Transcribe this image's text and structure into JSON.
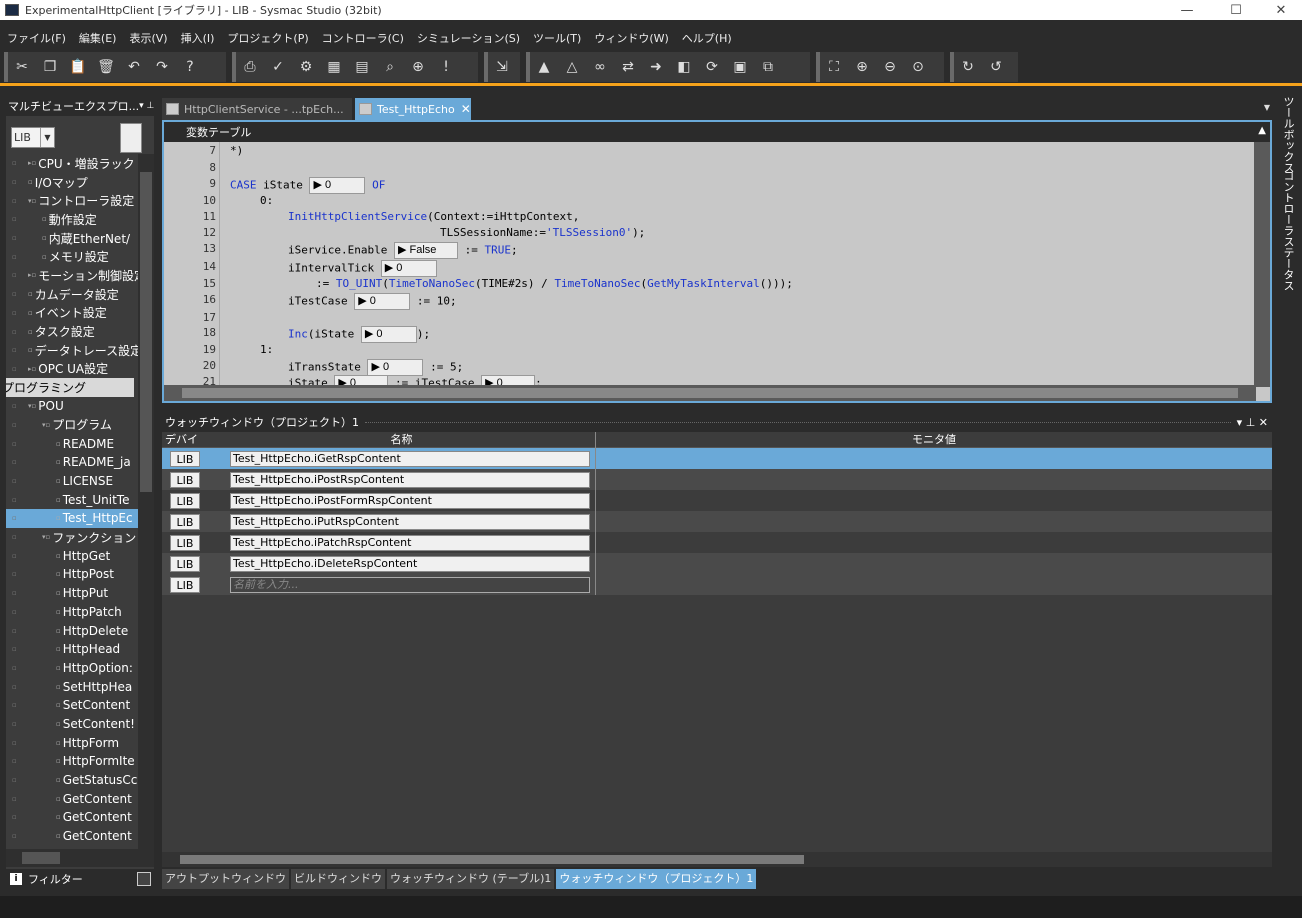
{
  "window": {
    "title": "ExperimentalHttpClient [ライブラリ] - LIB - Sysmac Studio (32bit)",
    "minimize": "—",
    "maximize": "☐",
    "close": "✕"
  },
  "menu": [
    "ファイル(F)",
    "編集(E)",
    "表示(V)",
    "挿入(I)",
    "プロジェクト(P)",
    "コントローラ(C)",
    "シミュレーション(S)",
    "ツール(T)",
    "ウィンドウ(W)",
    "ヘルプ(H)"
  ],
  "left_panel": {
    "title": "マルチビューエクスプロ...",
    "pin": "▾ ⊥",
    "selector_value": "LIB",
    "tree": [
      {
        "label": "CPU・増設ラック",
        "indent": 1,
        "icon": "▸▫"
      },
      {
        "label": "I/Oマップ",
        "indent": 1,
        "icon": "▫"
      },
      {
        "label": "コントローラ設定",
        "indent": 1,
        "icon": "▾▫"
      },
      {
        "label": "動作設定",
        "indent": 2,
        "icon": "▫"
      },
      {
        "label": "内蔵EtherNet/",
        "indent": 2,
        "icon": "▫"
      },
      {
        "label": "メモリ設定",
        "indent": 2,
        "icon": "▫"
      },
      {
        "label": "モーション制御設定",
        "indent": 1,
        "icon": "▸▫"
      },
      {
        "label": "カムデータ設定",
        "indent": 1,
        "icon": "▫"
      },
      {
        "label": "イベント設定",
        "indent": 1,
        "icon": "▫"
      },
      {
        "label": "タスク設定",
        "indent": 1,
        "icon": "▫"
      },
      {
        "label": "データトレース設定",
        "indent": 1,
        "icon": "▫"
      },
      {
        "label": "OPC UA設定",
        "indent": 1,
        "icon": "▸▫"
      },
      {
        "label": "プログラミング",
        "indent": 0,
        "icon": "",
        "group": true
      },
      {
        "label": "POU",
        "indent": 1,
        "icon": "▾▫"
      },
      {
        "label": "プログラム",
        "indent": 2,
        "icon": "▾▫"
      },
      {
        "label": "README",
        "indent": 3,
        "icon": "▫"
      },
      {
        "label": "README_ja",
        "indent": 3,
        "icon": "▫"
      },
      {
        "label": "LICENSE",
        "indent": 3,
        "icon": "▫"
      },
      {
        "label": "Test_UnitTe",
        "indent": 3,
        "icon": "▫"
      },
      {
        "label": "Test_HttpEc",
        "indent": 3,
        "icon": "▫",
        "selected": true
      },
      {
        "label": "ファンクション",
        "indent": 2,
        "icon": "▾▫"
      },
      {
        "label": "HttpGet",
        "indent": 3,
        "icon": "▫"
      },
      {
        "label": "HttpPost",
        "indent": 3,
        "icon": "▫"
      },
      {
        "label": "HttpPut",
        "indent": 3,
        "icon": "▫"
      },
      {
        "label": "HttpPatch",
        "indent": 3,
        "icon": "▫"
      },
      {
        "label": "HttpDelete",
        "indent": 3,
        "icon": "▫"
      },
      {
        "label": "HttpHead",
        "indent": 3,
        "icon": "▫"
      },
      {
        "label": "HttpOption:",
        "indent": 3,
        "icon": "▫"
      },
      {
        "label": "SetHttpHea",
        "indent": 3,
        "icon": "▫"
      },
      {
        "label": "SetContent",
        "indent": 3,
        "icon": "▫"
      },
      {
        "label": "SetContent!",
        "indent": 3,
        "icon": "▫"
      },
      {
        "label": "HttpForm",
        "indent": 3,
        "icon": "▫"
      },
      {
        "label": "HttpFormIte",
        "indent": 3,
        "icon": "▫"
      },
      {
        "label": "GetStatusCc",
        "indent": 3,
        "icon": "▫"
      },
      {
        "label": "GetContent",
        "indent": 3,
        "icon": "▫"
      },
      {
        "label": "GetContent",
        "indent": 3,
        "icon": "▫"
      },
      {
        "label": "GetContent",
        "indent": 3,
        "icon": "▫"
      }
    ],
    "filter_label": "フィルター"
  },
  "tabs": [
    {
      "label": "HttpClientService - ...tpEch...",
      "active": false
    },
    {
      "label": "Test_HttpEcho",
      "active": true,
      "close": "✕"
    }
  ],
  "editor": {
    "var_table_label": "変数テーブル",
    "lines": [
      {
        "n": "7",
        "code": "*)"
      },
      {
        "n": "8",
        "code": ""
      },
      {
        "n": "9",
        "code": "CASE iState [0] OF"
      },
      {
        "n": "10",
        "code": "0:"
      },
      {
        "n": "11",
        "code": "InitHttpClientService(Context:=iHttpContext,"
      },
      {
        "n": "12",
        "code": "TLSSessionName:='TLSSession0');"
      },
      {
        "n": "13",
        "code": "iService.Enable [False] := TRUE;"
      },
      {
        "n": "14",
        "code": "iIntervalTick [0]"
      },
      {
        "n": "15",
        "code": ":= TO_UINT(TimeToNanoSec(TIME#2s) / TimeToNanoSec(GetMyTaskInterval()));"
      },
      {
        "n": "16",
        "code": "iTestCase [0] := 10;"
      },
      {
        "n": "17",
        "code": ""
      },
      {
        "n": "18",
        "code": "Inc(iState [0]);"
      },
      {
        "n": "19",
        "code": "1:"
      },
      {
        "n": "20",
        "code": "iTransState [0] := 5;"
      },
      {
        "n": "21",
        "code": "iState [0] := iTestCase [0];"
      }
    ],
    "monitor_values": {
      "istate": "▶ 0",
      "enable": "▶ False",
      "tick": "▶ 0",
      "testcase": "▶ 0",
      "trans": "▶ 0"
    }
  },
  "watch": {
    "title": "ウォッチウィンドウ（プロジェクト）1",
    "columns": {
      "device": "デバイス",
      "name": "名称",
      "value": "モニタ値"
    },
    "rows": [
      {
        "device": "LIB",
        "name": "Test_HttpEcho.iGetRspContent",
        "value": "",
        "selected": true
      },
      {
        "device": "LIB",
        "name": "Test_HttpEcho.iPostRspContent",
        "value": ""
      },
      {
        "device": "LIB",
        "name": "Test_HttpEcho.iPostFormRspContent",
        "value": ""
      },
      {
        "device": "LIB",
        "name": "Test_HttpEcho.iPutRspContent",
        "value": ""
      },
      {
        "device": "LIB",
        "name": "Test_HttpEcho.iPatchRspContent",
        "value": ""
      },
      {
        "device": "LIB",
        "name": "Test_HttpEcho.iDeleteRspContent",
        "value": ""
      }
    ],
    "new_row": {
      "device": "LIB",
      "placeholder": "名前を入力..."
    },
    "controls": "▾ ⊥ ✕"
  },
  "bottom_tabs": [
    {
      "label": "アウトプットウィンドウ",
      "active": false
    },
    {
      "label": "ビルドウィンドウ",
      "active": false
    },
    {
      "label": "ウォッチウィンドウ (テーブル)1",
      "active": false
    },
    {
      "label": "ウォッチウィンドウ（プロジェクト）1",
      "active": true
    }
  ],
  "right_strip": [
    "ツールボックス",
    "コントローラステータス"
  ],
  "colors": {
    "accent": "#f5a21b",
    "selection": "#6aa9d8",
    "keyword": "#1a33cc"
  }
}
